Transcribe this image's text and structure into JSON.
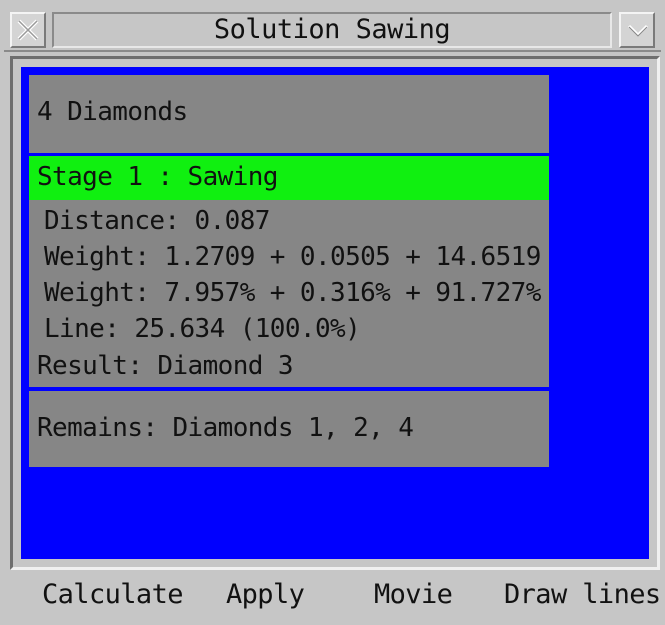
{
  "window": {
    "title": "Solution Sawing"
  },
  "panel": {
    "header": "4 Diamonds",
    "stage_title": "Stage 1 : Sawing",
    "distance": "Distance: 0.087",
    "weight_abs": "Weight: 1.2709 + 0.0505 + 14.6519",
    "weight_pct": "Weight: 7.957% + 0.316% + 91.727%",
    "line": "Line: 25.634 (100.0%)",
    "result": "Result: Diamond 3",
    "remains": "Remains: Diamonds 1, 2, 4"
  },
  "buttons": {
    "calculate": "Calculate",
    "apply": "Apply",
    "movie": "Movie",
    "draw_lines": "Draw lines"
  },
  "colors": {
    "canvas": "#0000ff",
    "panel": "#868686",
    "stage_highlight": "#10f010",
    "chrome": "#c6c6c6"
  },
  "icons": {
    "close": "close-icon",
    "menu": "chevron-down-icon"
  }
}
